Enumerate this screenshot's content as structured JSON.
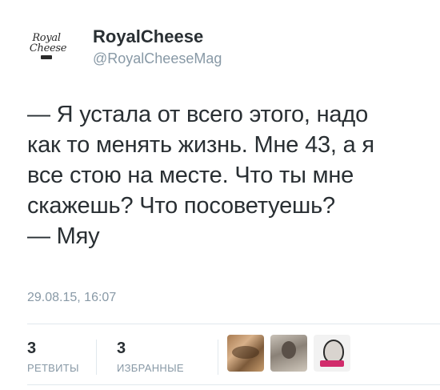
{
  "user": {
    "display_name": "RoyalCheese",
    "handle": "@RoyalCheeseMag",
    "avatar_logo_line1": "Royal",
    "avatar_logo_line2": "Cheese"
  },
  "tweet": {
    "lines": [
      "— Я устала от всего этого, надо",
      "как то менять жизнь. Мне 43, а я",
      "все стою на месте. Что ты мне",
      "скажешь? Что посоветуешь?",
      "— Мяу"
    ],
    "timestamp": "29.08.15, 16:07"
  },
  "stats": {
    "retweets_count": "3",
    "retweets_label": "РЕТВИТЫ",
    "favorites_count": "3",
    "favorites_label": "ИЗБРАННЫЕ"
  },
  "favorited_by_avatars": [
    "avatar-1",
    "avatar-2",
    "avatar-3"
  ]
}
